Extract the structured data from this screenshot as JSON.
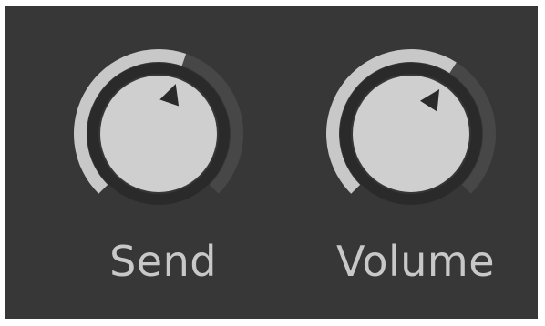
{
  "knobs": [
    {
      "id": "send",
      "label": "Send",
      "value_fraction": 0.57
    },
    {
      "id": "volume",
      "label": "Volume",
      "value_fraction": 0.62
    }
  ],
  "colors": {
    "panel": "#373737",
    "track_empty": "#474747",
    "track_filled": "#c8c8c8",
    "knob_face": "#cfcfcf",
    "knob_ring": "#2a2a2a",
    "pointer": "#2a2a2a",
    "label": "#c8c8c8"
  }
}
